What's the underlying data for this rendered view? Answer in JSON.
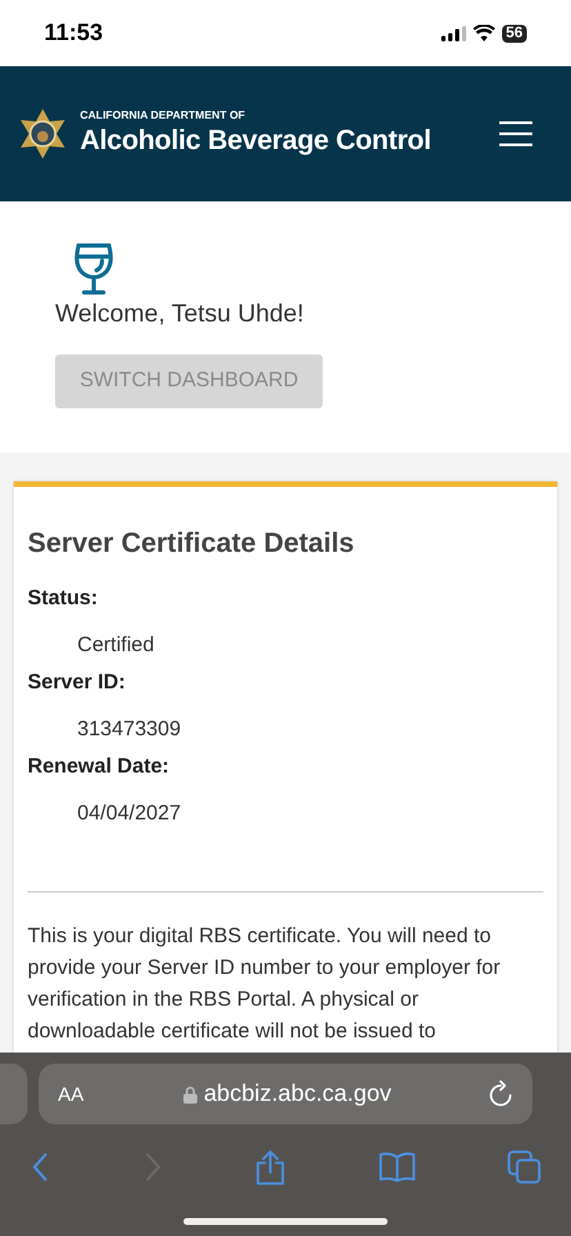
{
  "status_bar": {
    "time": "11:53",
    "battery": "56"
  },
  "header": {
    "subtitle": "CALIFORNIA DEPARTMENT OF",
    "title": "Alcoholic Beverage Control"
  },
  "welcome": {
    "text": "Welcome, Tetsu Uhde!",
    "button": {
      "label": "SWITCH DASHBOARD",
      "disabled": true
    }
  },
  "card": {
    "title": "Server Certificate Details",
    "fields": [
      {
        "label": "Status:",
        "value": "Certified"
      },
      {
        "label": "Server ID:",
        "value": "313473309"
      },
      {
        "label": "Renewal Date:",
        "value": "04/04/2027"
      }
    ],
    "paragraph": "This is your digital RBS certificate. You will need to provide your Server ID number to your employer for verification in the RBS Portal. A physical or downloadable certificate will not be issued to"
  },
  "browser": {
    "text_size": "AA",
    "url": "abcbiz.abc.ca.gov",
    "back_disabled": false,
    "forward_disabled": true
  }
}
